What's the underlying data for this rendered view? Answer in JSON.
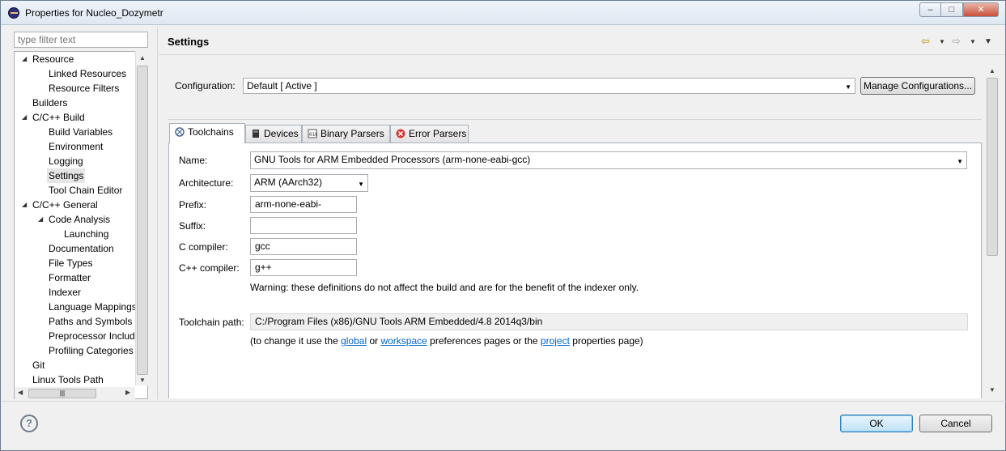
{
  "window": {
    "title": "Properties for Nucleo_Dozymetr",
    "min_glyph": "–",
    "max_glyph": "□",
    "close_glyph": "✕"
  },
  "sidebar": {
    "filter_placeholder": "type filter text",
    "items": [
      {
        "label": "Resource",
        "level": 0,
        "expanded": true
      },
      {
        "label": "Linked Resources",
        "level": 1
      },
      {
        "label": "Resource Filters",
        "level": 1
      },
      {
        "label": "Builders",
        "level": 0
      },
      {
        "label": "C/C++ Build",
        "level": 0,
        "expanded": true
      },
      {
        "label": "Build Variables",
        "level": 1
      },
      {
        "label": "Environment",
        "level": 1
      },
      {
        "label": "Logging",
        "level": 1
      },
      {
        "label": "Settings",
        "level": 1,
        "selected": true
      },
      {
        "label": "Tool Chain Editor",
        "level": 1
      },
      {
        "label": "C/C++ General",
        "level": 0,
        "expanded": true
      },
      {
        "label": "Code Analysis",
        "level": 1,
        "expanded": true
      },
      {
        "label": "Launching",
        "level": 2
      },
      {
        "label": "Documentation",
        "level": 1
      },
      {
        "label": "File Types",
        "level": 1
      },
      {
        "label": "Formatter",
        "level": 1
      },
      {
        "label": "Indexer",
        "level": 1
      },
      {
        "label": "Language Mappings",
        "level": 1
      },
      {
        "label": "Paths and Symbols",
        "level": 1
      },
      {
        "label": "Preprocessor Include",
        "level": 1
      },
      {
        "label": "Profiling Categories",
        "level": 1
      },
      {
        "label": "Git",
        "level": 0
      },
      {
        "label": "Linux Tools Path",
        "level": 0
      }
    ]
  },
  "header": {
    "title": "Settings",
    "back_icon": "back-arrow-icon",
    "forward_icon": "forward-arrow-icon"
  },
  "configuration": {
    "label": "Configuration:",
    "value": "Default  [ Active ]",
    "manage_button": "Manage Configurations..."
  },
  "tabs": [
    {
      "label": "Toolchains",
      "icon": "toolchains-icon",
      "active": true
    },
    {
      "label": "Devices",
      "icon": "devices-icon"
    },
    {
      "label": "Binary Parsers",
      "icon": "binary-parsers-icon"
    },
    {
      "label": "Error Parsers",
      "icon": "error-parsers-icon"
    }
  ],
  "toolchains": {
    "name_label": "Name:",
    "name_value": "GNU Tools for ARM Embedded Processors (arm-none-eabi-gcc)",
    "architecture_label": "Architecture:",
    "architecture_value": "ARM (AArch32)",
    "prefix_label": "Prefix:",
    "prefix_value": "arm-none-eabi-",
    "suffix_label": "Suffix:",
    "suffix_value": "",
    "c_compiler_label": "C compiler:",
    "c_compiler_value": "gcc",
    "cpp_compiler_label": "C++ compiler:",
    "cpp_compiler_value": "g++",
    "warning": "Warning: these definitions do not affect the build and are for the benefit of the indexer only.",
    "path_label": "Toolchain path:",
    "path_value": "C:/Program Files (x86)/GNU Tools ARM Embedded/4.8 2014q3/bin",
    "change_prefix": "(to change it use the ",
    "global_link": "global",
    "or_text": " or ",
    "workspace_link": "workspace",
    "middle_text": " preferences pages or the ",
    "project_link": "project",
    "suffix_text": " properties page)"
  },
  "footer": {
    "help_glyph": "?",
    "ok": "OK",
    "cancel": "Cancel"
  },
  "colors": {
    "accent_ok": "#3c7fb1",
    "link": "#0066cc",
    "error_icon": "#d23a3a"
  }
}
